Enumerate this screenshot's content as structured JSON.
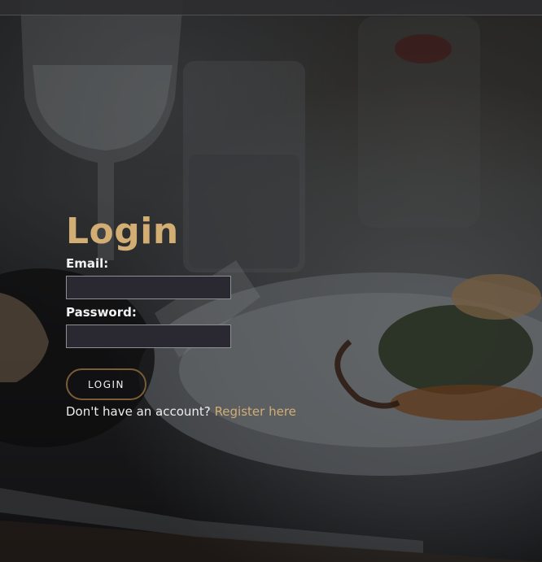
{
  "login": {
    "title": "Login",
    "email_label": "Email:",
    "email_value": "",
    "password_label": "Password:",
    "password_value": "",
    "button_label": "LOGIN",
    "register_prompt": "Don't have an account?",
    "register_link": "Register here"
  },
  "colors": {
    "accent": "#d2ad74",
    "input_bg": "#2a2931",
    "button_border": "#7a5d35"
  }
}
